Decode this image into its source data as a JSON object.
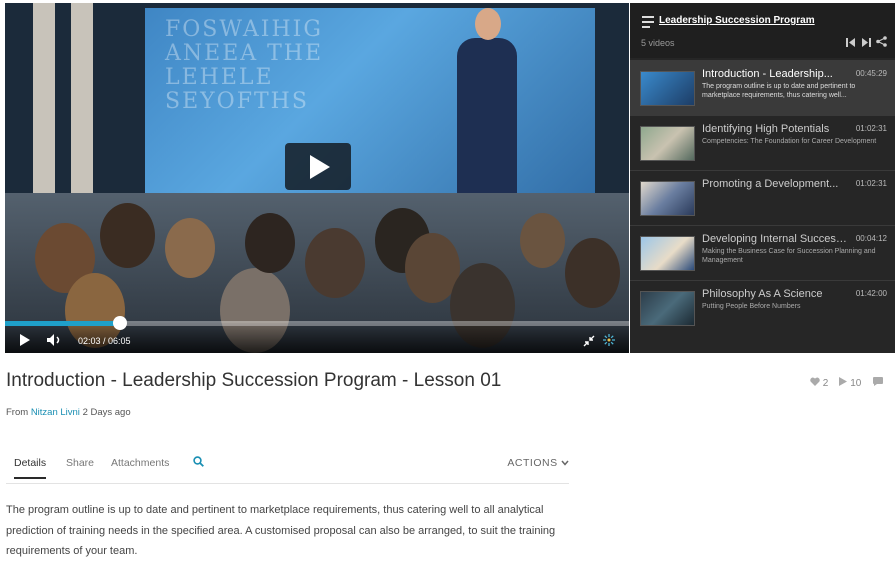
{
  "player": {
    "screen_lines": [
      "FOSWAIHIG",
      "ANEEA THE",
      "LEHELE",
      "SEYOFTHS"
    ],
    "time_display": "02:03 / 06:05",
    "progress": 0.185
  },
  "playlist": {
    "title": "Leadership Succession Program",
    "count": "5 videos",
    "items": [
      {
        "title": "Introduction - Leadership...",
        "duration": "00:45:29",
        "description": "The program outline is up to date and pertinent to marketplace requirements, thus catering well..."
      },
      {
        "title": "Identifying High Potentials",
        "duration": "01:02:31",
        "description": "Competencies: The Foundation for Career Development"
      },
      {
        "title": "Promoting a Development...",
        "duration": "01:02:31",
        "description": ""
      },
      {
        "title": "Developing Internal Successors",
        "duration": "00:04:12",
        "description": "Making the Business Case for Succession Planning and Management"
      },
      {
        "title": "Philosophy As A Science",
        "duration": "01:42:00",
        "description": "Putting People Before Numbers"
      }
    ]
  },
  "video": {
    "title": "Introduction - Leadership Succession Program - Lesson 01",
    "likes": "2",
    "plays": "10",
    "from_label": "From",
    "author": "Nitzan Livni",
    "posted": "2 Days ago"
  },
  "tabs": {
    "details": "Details",
    "share": "Share",
    "attachments": "Attachments",
    "actions": "ACTIONS"
  },
  "description": "The program outline is up to date and pertinent to marketplace requirements, thus catering well to all analytical prediction of training needs in the specified area. A customised proposal can also be arranged, to suit the training requirements of your team.",
  "colors": {
    "accent": "#1a8fb3",
    "progress": "#1fa0c9"
  }
}
